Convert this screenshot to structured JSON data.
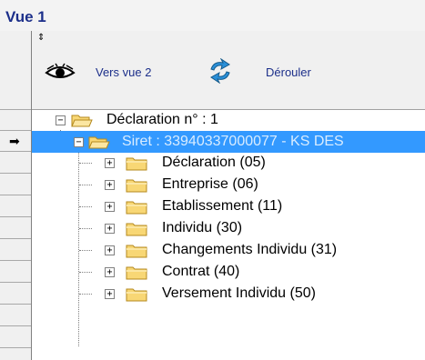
{
  "window": {
    "title": "Vue 1"
  },
  "toolbar": {
    "view2_label": "Vers vue 2",
    "expand_label": "Dérouler"
  },
  "tree": {
    "root": {
      "label": "Déclaration n° : 1"
    },
    "siret": {
      "label": "Siret : 33940337000077 - KS DES"
    },
    "children": [
      {
        "label": "Déclaration (05)"
      },
      {
        "label": "Entreprise (06)"
      },
      {
        "label": "Etablissement (11)"
      },
      {
        "label": "Individu (30)"
      },
      {
        "label": "Changements Individu (31)"
      },
      {
        "label": "Contrat (40)"
      },
      {
        "label": "Versement Individu (50)"
      }
    ]
  },
  "colors": {
    "title": "#1c2f8a",
    "selection": "#3399ff",
    "folder": "#f8d775"
  }
}
